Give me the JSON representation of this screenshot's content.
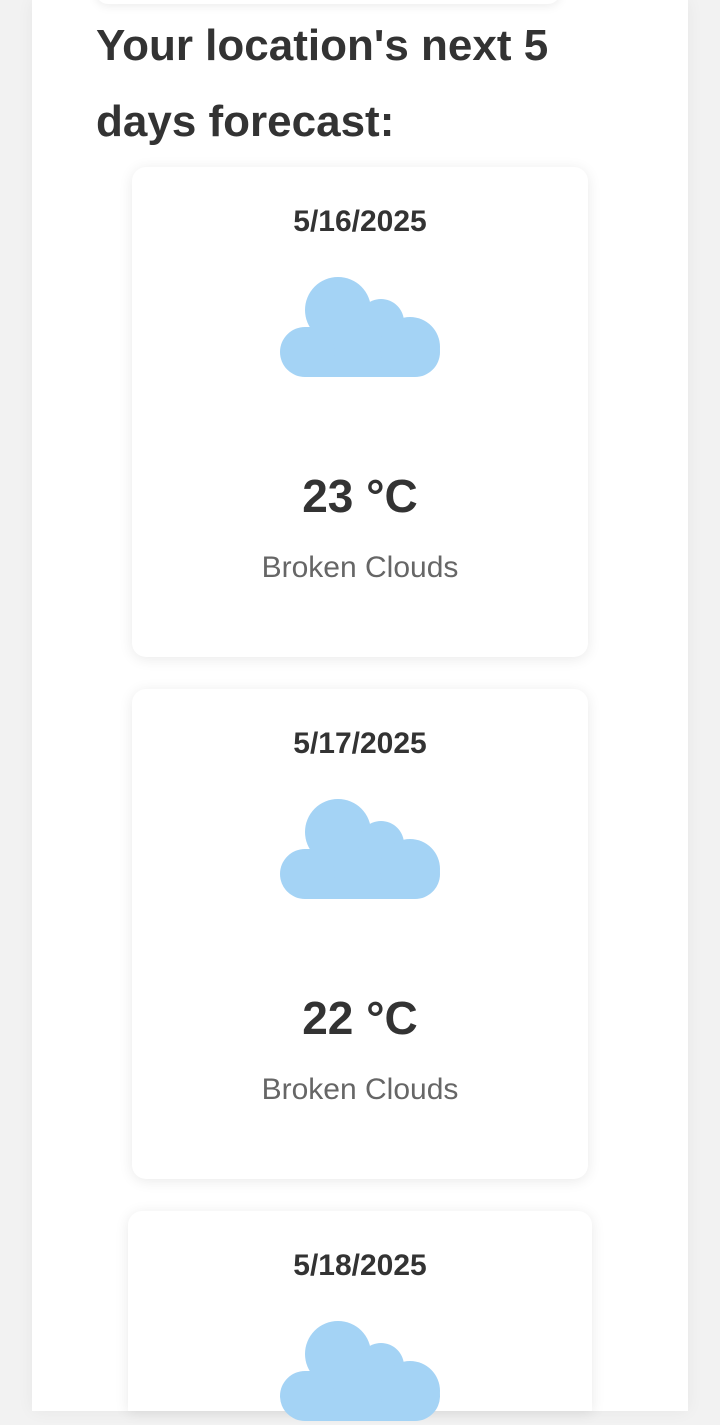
{
  "forecast": {
    "title": "Your location's next 5 days forecast:",
    "cloud_color": "#a4d3f5",
    "days": [
      {
        "date": "5/16/2025",
        "temperature": "23 °C",
        "description": "Broken Clouds",
        "icon": "cloud-icon"
      },
      {
        "date": "5/17/2025",
        "temperature": "22 °C",
        "description": "Broken Clouds",
        "icon": "cloud-icon"
      },
      {
        "date": "5/18/2025",
        "temperature": "",
        "description": "",
        "icon": "cloud-icon"
      }
    ]
  }
}
